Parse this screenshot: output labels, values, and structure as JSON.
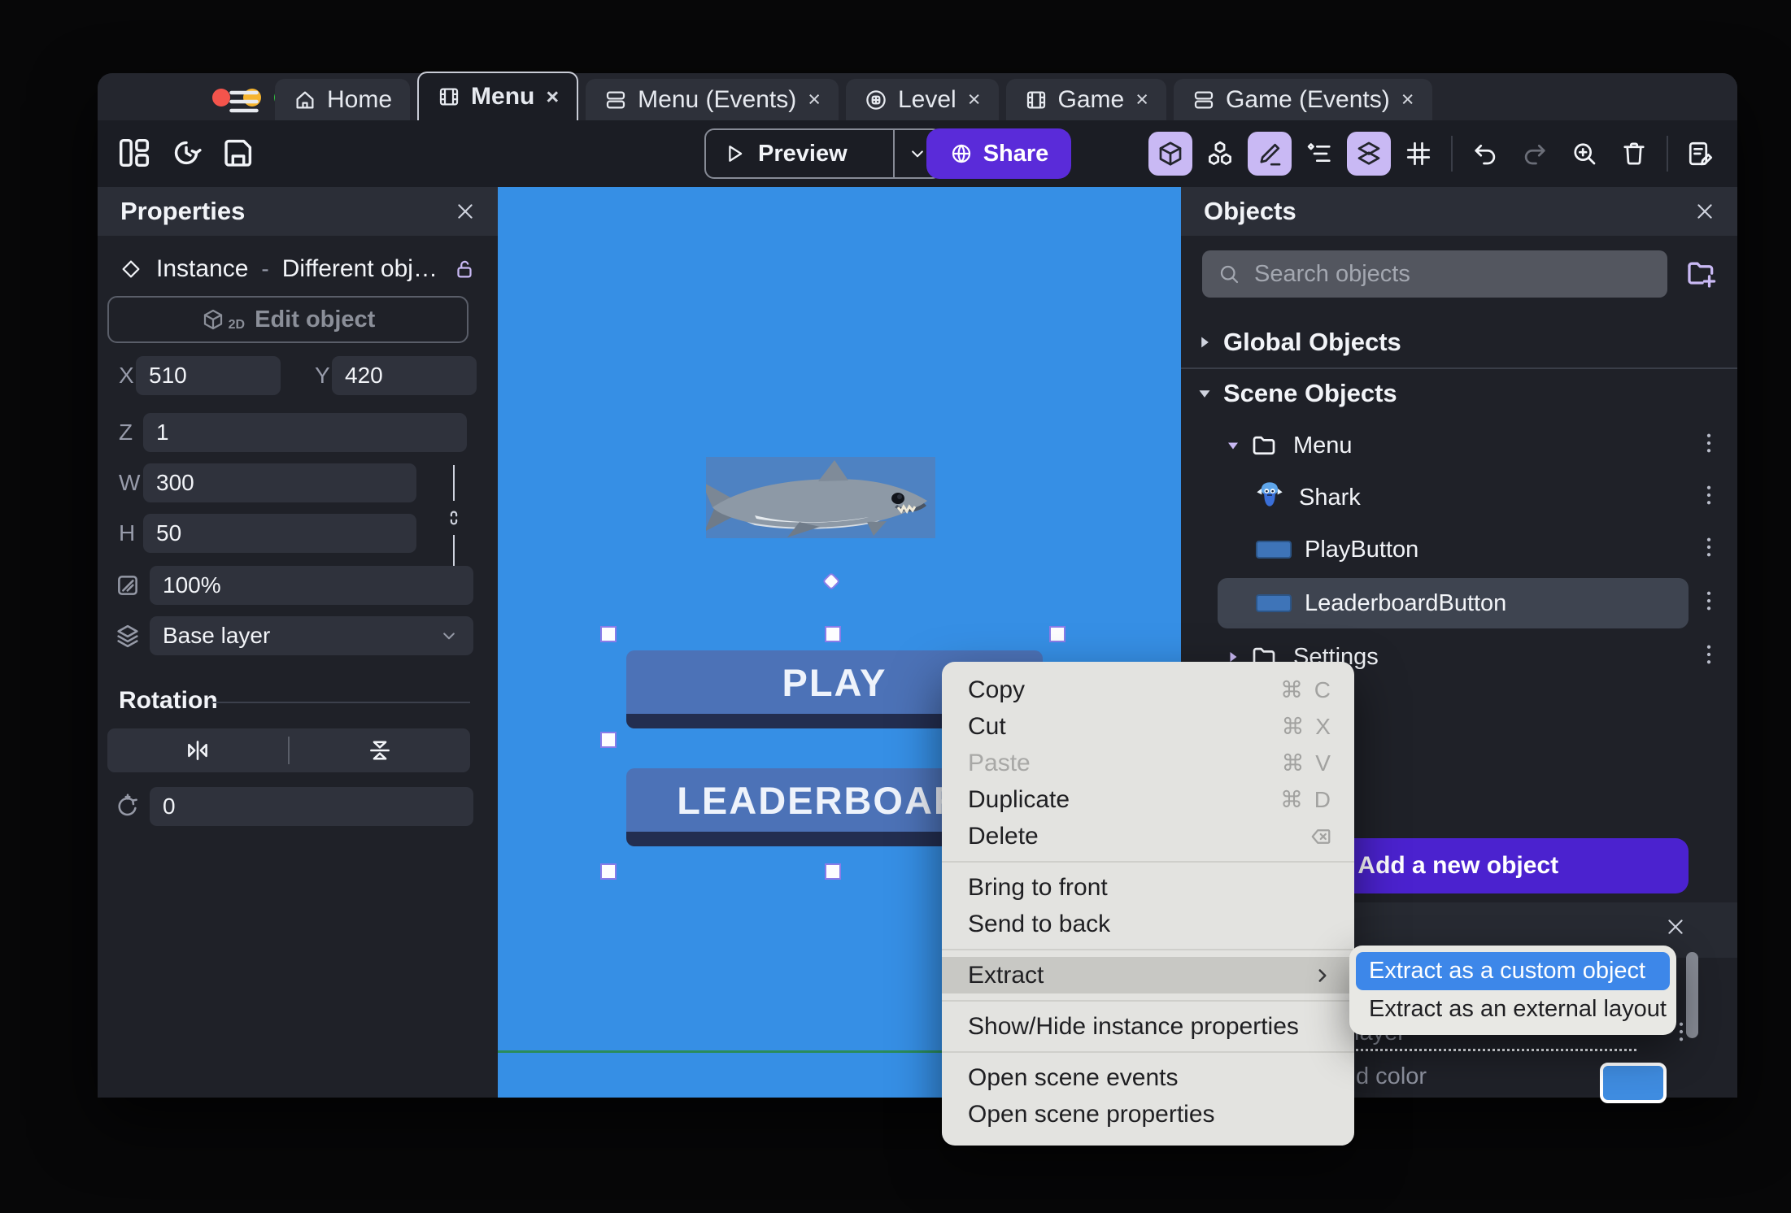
{
  "window": {
    "tabs": [
      {
        "label": "Home",
        "glyph": "home",
        "icon_name": "home-icon",
        "active": false,
        "closable": false
      },
      {
        "label": "Menu",
        "glyph": "film",
        "icon_name": "scene-icon",
        "active": true,
        "closable": true
      },
      {
        "label": "Menu (Events)",
        "glyph": "events",
        "icon_name": "events-sheet-icon",
        "active": false,
        "closable": true
      },
      {
        "label": "Level",
        "glyph": "level",
        "icon_name": "external-layout-icon",
        "active": false,
        "closable": true
      },
      {
        "label": "Game",
        "glyph": "film",
        "icon_name": "scene-icon",
        "active": false,
        "closable": true
      },
      {
        "label": "Game (Events)",
        "glyph": "events",
        "icon_name": "events-sheet-icon",
        "active": false,
        "closable": true
      }
    ],
    "close_glyph": "×"
  },
  "toolbar": {
    "left_icons": [
      {
        "glyph": "panel",
        "icon_name": "toggle-panels-icon"
      },
      {
        "glyph": "history",
        "icon_name": "history-icon"
      },
      {
        "glyph": "save",
        "icon_name": "save-icon"
      }
    ],
    "preview_label": "Preview",
    "share_label": "Share",
    "right_icons": [
      {
        "glyph": "cube",
        "icon_name": "edit-object-3d-icon",
        "highlighted": true
      },
      {
        "glyph": "cubes",
        "icon_name": "objects-list-icon",
        "highlighted": false
      },
      {
        "glyph": "pencil",
        "icon_name": "edit-mode-icon",
        "highlighted": true
      },
      {
        "glyph": "instr",
        "icon_name": "instances-list-icon",
        "highlighted": false
      },
      {
        "glyph": "layers2",
        "icon_name": "layers-list-icon",
        "highlighted": true
      },
      {
        "glyph": "grid",
        "icon_name": "grid-icon",
        "highlighted": false
      },
      {
        "sep": true
      },
      {
        "glyph": "undo",
        "icon_name": "undo-icon",
        "highlighted": false
      },
      {
        "glyph": "redo",
        "icon_name": "redo-icon",
        "highlighted": false,
        "dimmed": true
      },
      {
        "glyph": "zoomin",
        "icon_name": "zoom-in-icon",
        "highlighted": false
      },
      {
        "glyph": "trash",
        "icon_name": "delete-icon",
        "highlighted": false
      },
      {
        "sep": true
      },
      {
        "glyph": "sheetpencil",
        "icon_name": "scene-properties-icon",
        "highlighted": false
      }
    ],
    "colors": {
      "share_bg": "#5a2bd9",
      "highlight_bg": "#c9b9f4"
    }
  },
  "properties_panel": {
    "title": "Properties",
    "instance": {
      "type_label": "Instance",
      "separator": "-",
      "value": "Different obj…"
    },
    "edit_object_label": "Edit object",
    "edit_object_badge": "2D",
    "fields": {
      "x_label": "X",
      "x_value": "510",
      "y_label": "Y",
      "y_value": "420",
      "z_label": "Z",
      "z_value": "1",
      "w_label": "W",
      "w_value": "300",
      "h_label": "H",
      "h_value": "50",
      "opacity_value": "100%",
      "layer_value": "Base layer"
    },
    "rotation": {
      "title": "Rotation",
      "angle_value": "0"
    }
  },
  "canvas": {
    "background_color": "#368fe5",
    "play_button_label": "PLAY",
    "leaderboard_button_label": "LEADERBOARD",
    "button_color": "#4c72b7",
    "scene_border_color": "#2a8c5c"
  },
  "objects_panel": {
    "title": "Objects",
    "search_placeholder": "Search objects",
    "sections": [
      {
        "label": "Global Objects",
        "expanded": false
      },
      {
        "label": "Scene Objects",
        "expanded": true
      }
    ],
    "tree": [
      {
        "label": "Menu",
        "kind": "folder",
        "expanded": true,
        "depth": 0,
        "selected": false
      },
      {
        "label": "Shark",
        "kind": "shark-sprite",
        "depth": 1,
        "selected": false
      },
      {
        "label": "PlayButton",
        "kind": "button-object",
        "depth": 1,
        "selected": false
      },
      {
        "label": "LeaderboardButton",
        "kind": "button-object",
        "depth": 1,
        "selected": true
      },
      {
        "label": "Settings",
        "kind": "folder",
        "expanded": false,
        "depth": 0,
        "selected": false
      }
    ],
    "add_button_label": "Add a new object",
    "add_button_plus": "+",
    "add_button_color": "#4b22cf"
  },
  "layers_panel": {
    "truncated_layer_text": "layer",
    "truncated_color_text": "d color",
    "swatch_color": "#3f8ce0"
  },
  "context_menu": {
    "items": [
      {
        "label": "Copy",
        "shortcut": "⌘ C"
      },
      {
        "label": "Cut",
        "shortcut": "⌘ X"
      },
      {
        "label": "Paste",
        "shortcut": "⌘ V",
        "disabled": true
      },
      {
        "label": "Duplicate",
        "shortcut": "⌘ D"
      },
      {
        "label": "Delete",
        "shortcut_glyph": "backspace",
        "shortcut_icon_name": "backspace-icon"
      },
      {
        "divider": true
      },
      {
        "label": "Bring to front"
      },
      {
        "label": "Send to back"
      },
      {
        "divider": true
      },
      {
        "label": "Extract",
        "highlighted": true,
        "has_submenu": true
      },
      {
        "divider": true
      },
      {
        "label": "Show/Hide instance properties"
      },
      {
        "divider": true
      },
      {
        "label": "Open scene events"
      },
      {
        "label": "Open scene properties"
      }
    ],
    "submenu": {
      "items": [
        {
          "label": "Extract as a custom object",
          "selected": true
        },
        {
          "label": "Extract as an external layout",
          "selected": false
        }
      ],
      "selected_color": "#3d87e9"
    }
  }
}
